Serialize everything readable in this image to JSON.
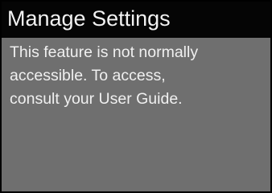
{
  "screen": {
    "title": "Manage Settings",
    "message_lines": [
      "This feature is not normally",
      "accessible. To access,",
      "consult your User Guide."
    ]
  },
  "colors": {
    "title_bar_background": "#050505",
    "panel_background": "#6f6f6f",
    "text": "#f0f0f0",
    "frame": "#000000"
  }
}
